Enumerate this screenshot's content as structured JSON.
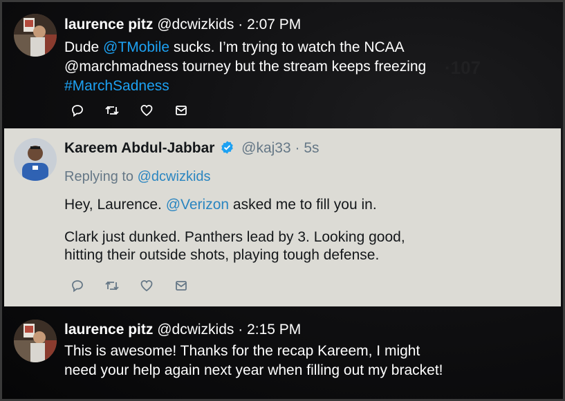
{
  "tweets": [
    {
      "name": "laurence pitz",
      "handle": "@dcwizkids",
      "sep": " · ",
      "time": "2:07 PM",
      "text": {
        "line1_pre": "Dude ",
        "line1_link": "@TMobile",
        "line1_post": " sucks. I’m trying to watch the NCAA",
        "line2": "@marchmadness tourney but the stream keeps freezing",
        "line3_hashtag": "#MarchSadness"
      },
      "icons": [
        "reply-icon",
        "retweet-icon",
        "like-icon",
        "dm-icon"
      ]
    },
    {
      "name": "Kareem Abdul-Jabbar",
      "verified": true,
      "handle": "@kaj33",
      "sep": " · ",
      "time": "5s",
      "replying_pre": "Replying to ",
      "replying_handle": "@dcwizkids",
      "text": {
        "line1_pre": "Hey, Laurence. ",
        "line1_link": "@Verizon",
        "line1_post": " asked me to fill you in.",
        "line2": "Clark just dunked. Panthers lead by 3. Looking good,",
        "line3": "hitting their outside shots, playing tough defense."
      },
      "icons": [
        "reply-icon",
        "retweet-icon",
        "like-icon",
        "dm-icon"
      ]
    },
    {
      "name": "laurence pitz",
      "handle": "@dcwizkids",
      "sep": " · ",
      "time": "2:15 PM",
      "text": {
        "line1": "This is awesome! Thanks for the recap Kareem, I might",
        "line2": "need your help again next year when filling out my bracket!"
      }
    }
  ],
  "colors": {
    "link": "#1da1f2",
    "verified": "#1da1f2",
    "light_bg": "#dcdbd5"
  }
}
